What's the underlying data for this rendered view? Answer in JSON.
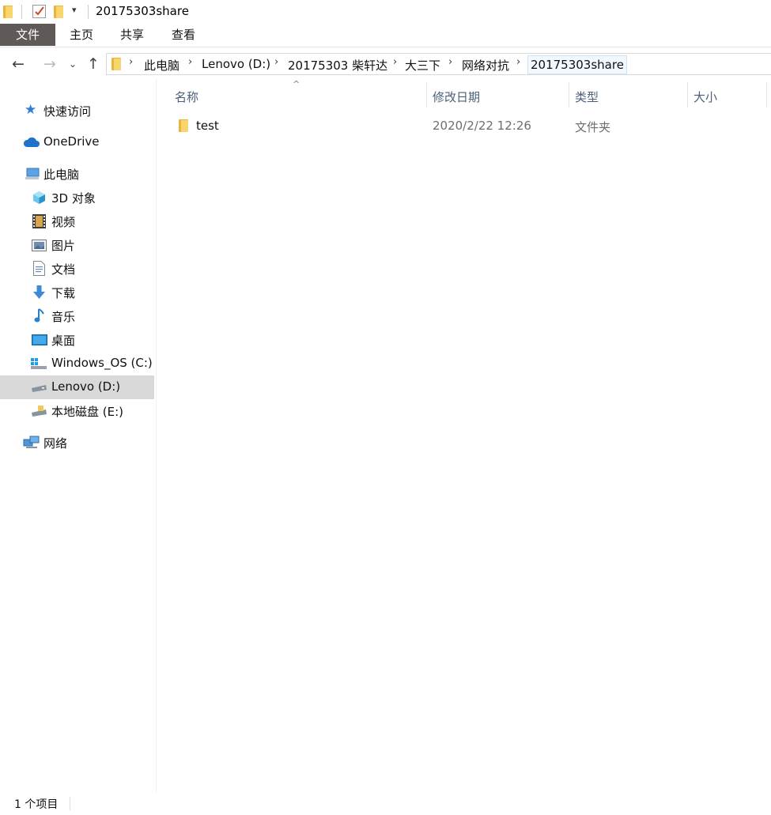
{
  "window": {
    "title": "20175303share"
  },
  "ribbon": {
    "tabs": [
      "文件",
      "主页",
      "共享",
      "查看"
    ]
  },
  "breadcrumb": [
    "此电脑",
    "Lenovo (D:)",
    "20175303 柴轩达",
    "大三下",
    "网络对抗",
    "20175303share"
  ],
  "sidebar": {
    "quick_access": "快速访问",
    "onedrive": "OneDrive",
    "this_pc": "此电脑",
    "items": [
      {
        "label": "3D 对象",
        "icon": "cube-3d-icon"
      },
      {
        "label": "视频",
        "icon": "film-icon"
      },
      {
        "label": "图片",
        "icon": "picture-icon"
      },
      {
        "label": "文档",
        "icon": "document-icon"
      },
      {
        "label": "下载",
        "icon": "download-arrow-icon"
      },
      {
        "label": "音乐",
        "icon": "music-note-icon"
      },
      {
        "label": "桌面",
        "icon": "desktop-icon"
      },
      {
        "label": "Windows_OS (C:)",
        "icon": "windows-drive-icon"
      },
      {
        "label": "Lenovo (D:)",
        "icon": "drive-icon",
        "selected": true
      },
      {
        "label": "本地磁盘 (E:)",
        "icon": "drive-icon"
      }
    ],
    "network": "网络"
  },
  "columns": {
    "name": "名称",
    "modified": "修改日期",
    "type": "类型",
    "size": "大小"
  },
  "files": [
    {
      "name": "test",
      "modified": "2020/2/22 12:26",
      "type": "文件夹",
      "size": ""
    }
  ],
  "status": {
    "count": "1 个项目"
  },
  "colors": {
    "selected_bg": "#d9d9d9",
    "file_tab_bg": "#5f5a57",
    "folder_yellow": "#f9d56e",
    "header_text": "#4c607a"
  }
}
